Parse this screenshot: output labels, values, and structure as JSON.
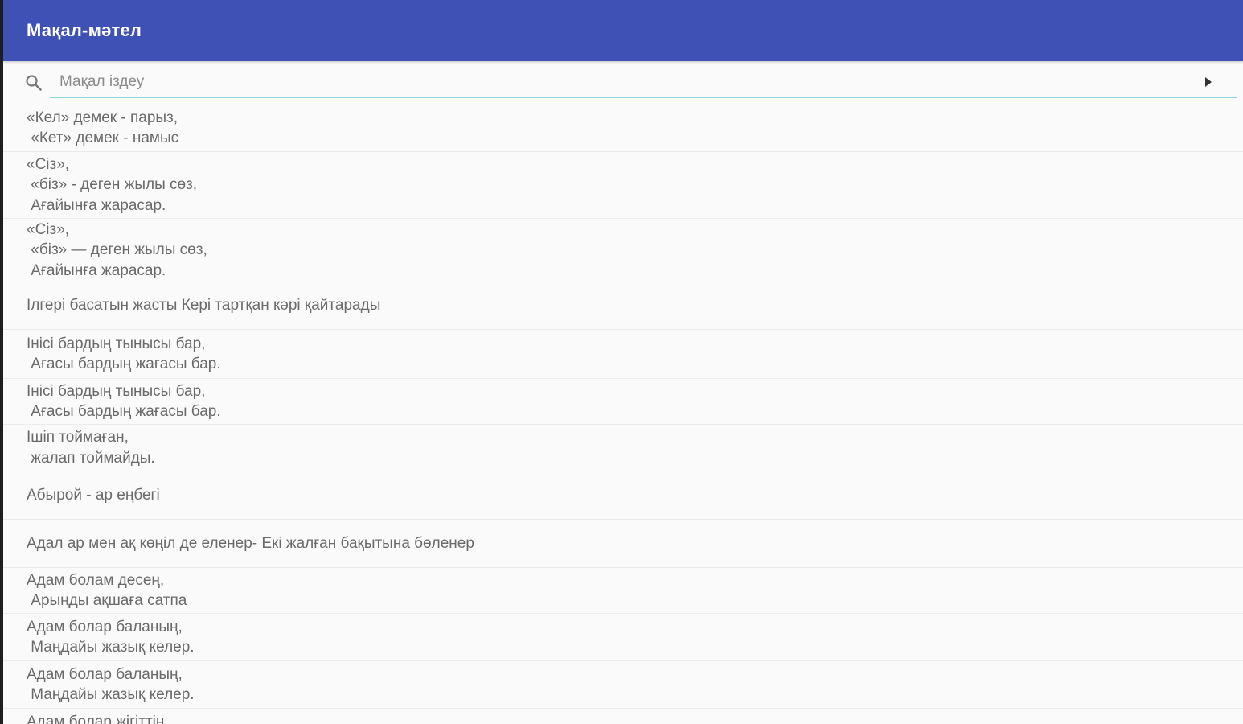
{
  "app": {
    "title": "Мақал-мәтел"
  },
  "search": {
    "placeholder": "Мақал іздеу",
    "value": ""
  },
  "colors": {
    "toolbar": "#3f51b5",
    "underline": "#8fd3dd",
    "text": "#6a6a6a"
  },
  "icons": {
    "search": "search-icon",
    "submit": "play-arrow-icon"
  },
  "proverbs": [
    "«Кел» демек - парыз,\n «Кет» демек - намыс",
    "«Сіз»,\n «біз» - деген жылы сөз,\n Ағайынға жарасар.",
    "«Сіз»,\n «біз» — деген жылы сөз,\n Ағайынға жарасар.",
    "Ілгері басатын жасты Кері тартқан кәрі қайтарады",
    "Інісі бардың тынысы бар,\n Ағасы бардың жағасы бар.",
    "Інісі бардың тынысы бар,\n Ағасы бардың жағасы бар.",
    "Ішіп тоймаған,\n жалап тоймайды.",
    "Абырой - ар еңбегі",
    "Адал ар мен ақ көңіл де еленер- Екі жалған бақытына бөленер",
    "Адам болам десең,\n Арыңды ақшаға сатпа",
    "Адам болар баланың,\n Маңдайы жазық келер.",
    "Адам болар баланың,\n Маңдайы жазық келер.",
    "Адам болар жігіттің"
  ]
}
